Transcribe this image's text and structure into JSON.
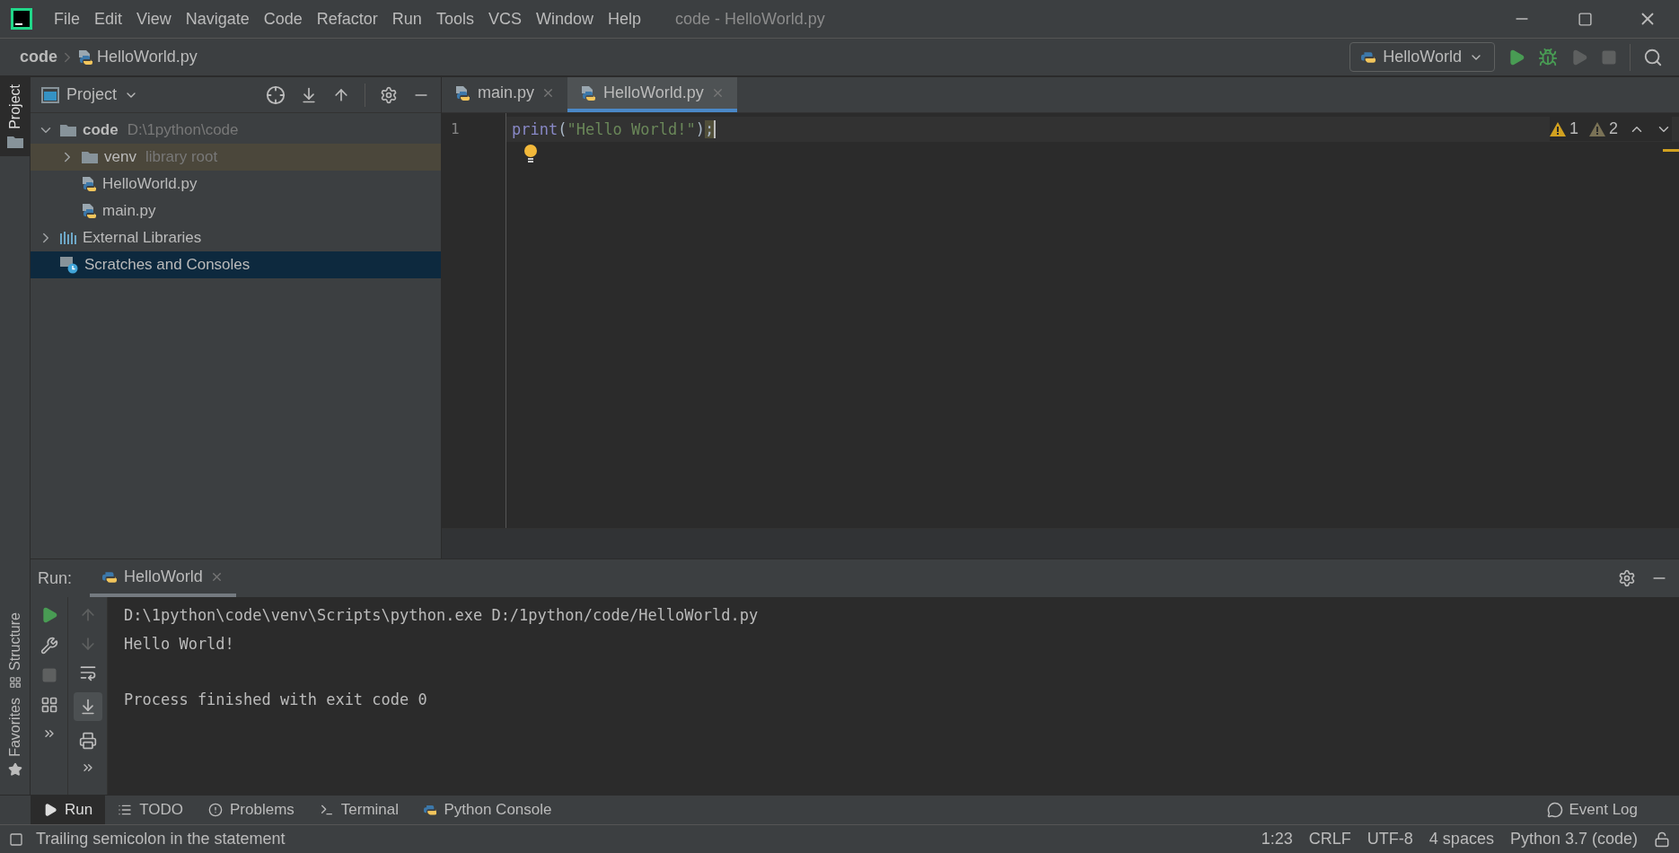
{
  "window": {
    "title": "code - HelloWorld.py"
  },
  "menu": [
    {
      "label": "File"
    },
    {
      "label": "Edit"
    },
    {
      "label": "View"
    },
    {
      "label": "Navigate"
    },
    {
      "label": "Code"
    },
    {
      "label": "Refactor"
    },
    {
      "label": "Run"
    },
    {
      "label": "Tools"
    },
    {
      "label": "VCS"
    },
    {
      "label": "Window"
    },
    {
      "label": "Help"
    }
  ],
  "breadcrumbs": [
    {
      "label": "code",
      "kind": "folder"
    },
    {
      "label": "HelloWorld.py",
      "kind": "python"
    }
  ],
  "run_config": "HelloWorld",
  "side_strip": {
    "top": [
      {
        "label": "Project",
        "selected": true
      }
    ],
    "bottom": [
      {
        "label": "Structure",
        "selected": false
      },
      {
        "label": "Favorites",
        "selected": false
      }
    ]
  },
  "project_panel": {
    "title": "Project",
    "tree": [
      {
        "name": "code",
        "hint": "D:\\1python\\code",
        "kind": "folder",
        "expanded": true,
        "selected": false,
        "children": [
          {
            "name": "venv",
            "hint": "library root",
            "kind": "library",
            "expanded": false,
            "selected": false
          },
          {
            "name": "HelloWorld.py",
            "kind": "python",
            "selected": false
          },
          {
            "name": "main.py",
            "kind": "python",
            "selected": false
          }
        ]
      },
      {
        "name": "External Libraries",
        "kind": "libraries",
        "expanded": false,
        "selected": false
      },
      {
        "name": "Scratches and Consoles",
        "kind": "scratches",
        "selected": true
      }
    ]
  },
  "editor": {
    "tabs": [
      {
        "label": "main.py",
        "selected": false
      },
      {
        "label": "HelloWorld.py",
        "selected": true
      }
    ],
    "lines": [
      {
        "number": "1",
        "tokens": [
          {
            "text": "print",
            "kind": "builtin"
          },
          {
            "text": "(",
            "kind": "punct"
          },
          {
            "text": "\"Hello World!\"",
            "kind": "string"
          },
          {
            "text": ")",
            "kind": "punct"
          },
          {
            "text": ";",
            "kind": "warning"
          }
        ]
      }
    ],
    "inspections": [
      {
        "count": "1",
        "kind": "warning"
      },
      {
        "count": "2",
        "kind": "weak"
      }
    ]
  },
  "run_panel": {
    "label": "Run:",
    "tabs": [
      {
        "label": "HelloWorld",
        "selected": true
      }
    ],
    "output": [
      {
        "text": "D:\\1python\\code\\venv\\Scripts\\python.exe D:/1python/code/HelloWorld.py",
        "kind": "line"
      },
      {
        "text": "Hello World!",
        "kind": "line"
      },
      {
        "text": "Process finished with exit code 0",
        "kind": "gap"
      }
    ]
  },
  "tool_windows": [
    {
      "label": "Run",
      "kind": "run",
      "selected": true
    },
    {
      "label": "TODO",
      "kind": "todo",
      "selected": false
    },
    {
      "label": "Problems",
      "kind": "problems",
      "selected": false
    },
    {
      "label": "Terminal",
      "kind": "terminal",
      "selected": false
    },
    {
      "label": "Python Console",
      "kind": "console",
      "selected": false
    }
  ],
  "event_log": "Event Log",
  "status_bar": {
    "message": "Trailing semicolon in the statement",
    "items": [
      "1:23",
      "CRLF",
      "UTF-8",
      "4 spaces",
      "Python 3.7 (code)"
    ]
  }
}
